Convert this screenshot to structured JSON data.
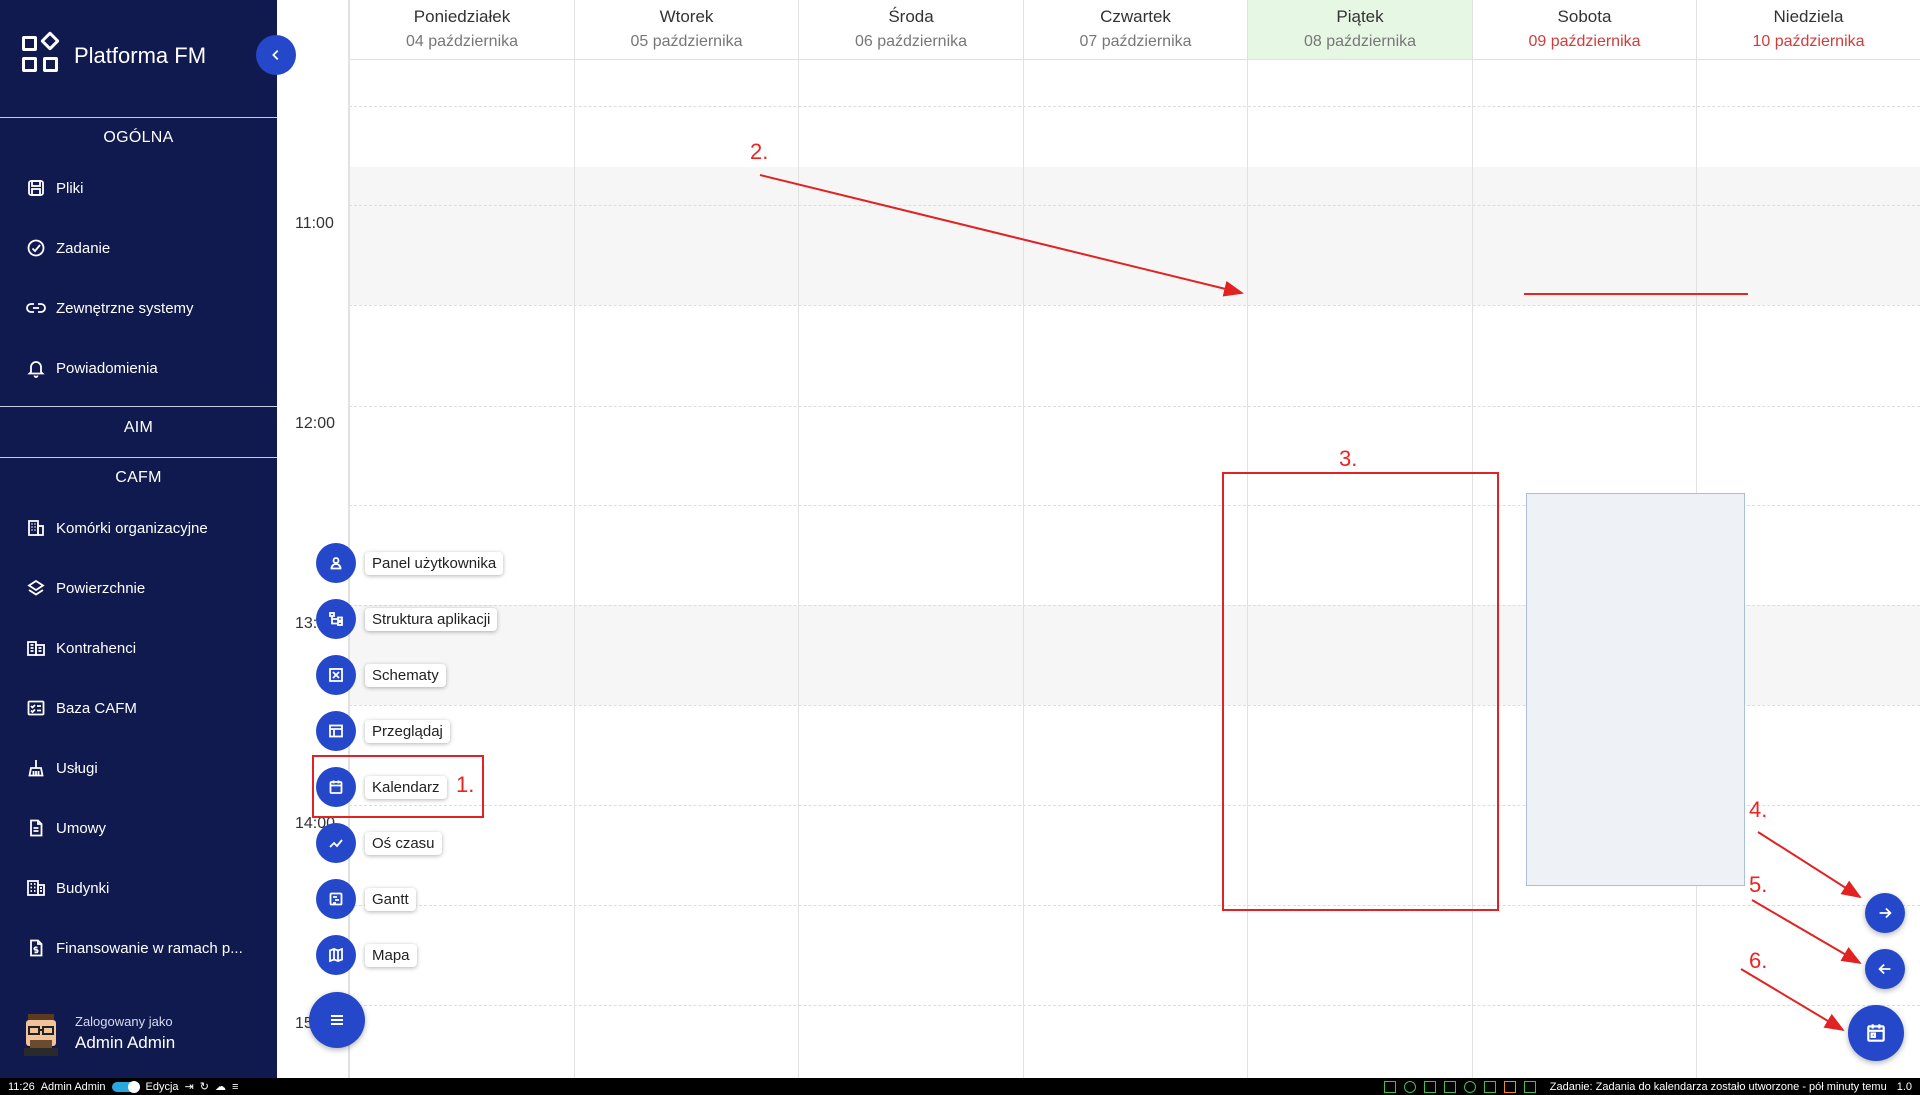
{
  "app": {
    "title": "Platforma FM"
  },
  "sidebar": {
    "sections": {
      "general": "OGÓLNA",
      "aim": "AIM",
      "cafm": "CAFM"
    },
    "general_items": [
      {
        "label": "Pliki",
        "icon": "save-icon"
      },
      {
        "label": "Zadanie",
        "icon": "check-circle-icon"
      },
      {
        "label": "Zewnętrzne systemy",
        "icon": "link-icon"
      },
      {
        "label": "Powiadomienia",
        "icon": "bell-icon"
      }
    ],
    "cafm_items": [
      {
        "label": "Komórki organizacyjne",
        "icon": "building-icon"
      },
      {
        "label": "Powierzchnie",
        "icon": "layers-icon"
      },
      {
        "label": "Kontrahenci",
        "icon": "contractors-icon"
      },
      {
        "label": "Baza CAFM",
        "icon": "checklist-icon"
      },
      {
        "label": "Usługi",
        "icon": "cleaning-icon"
      },
      {
        "label": "Umowy",
        "icon": "document-icon"
      },
      {
        "label": "Budynki",
        "icon": "buildings-icon"
      },
      {
        "label": "Finansowanie w ramach p...",
        "icon": "finance-doc-icon"
      }
    ],
    "user": {
      "caption": "Zalogowany jako",
      "name": "Admin Admin"
    }
  },
  "calendar": {
    "days": [
      {
        "name": "Poniedziałek",
        "date": "04 października",
        "weekend": false,
        "today": false
      },
      {
        "name": "Wtorek",
        "date": "05 października",
        "weekend": false,
        "today": false
      },
      {
        "name": "Środa",
        "date": "06 października",
        "weekend": false,
        "today": false
      },
      {
        "name": "Czwartek",
        "date": "07 października",
        "weekend": false,
        "today": false
      },
      {
        "name": "Piątek",
        "date": "08 października",
        "weekend": false,
        "today": true
      },
      {
        "name": "Sobota",
        "date": "09 października",
        "weekend": true,
        "today": false
      },
      {
        "name": "Niedziela",
        "date": "10 października",
        "weekend": true,
        "today": false
      }
    ],
    "times": [
      "11:00",
      "12:00",
      "13:00",
      "14:00",
      "15:00"
    ],
    "colors": {
      "today_bg": "#e6f7e3",
      "weekend_text": "#d23b3b",
      "accent": "#2547c9"
    }
  },
  "speed_dial": {
    "items": [
      {
        "label": "Panel użytkownika",
        "icon": "user-icon"
      },
      {
        "label": "Struktura aplikacji",
        "icon": "sitemap-icon"
      },
      {
        "label": "Schematy",
        "icon": "schema-icon"
      },
      {
        "label": "Przeglądaj",
        "icon": "table-icon"
      },
      {
        "label": "Kalendarz",
        "icon": "calendar-icon"
      },
      {
        "label": "Oś czasu",
        "icon": "timeline-icon"
      },
      {
        "label": "Gantt",
        "icon": "gantt-icon"
      },
      {
        "label": "Mapa",
        "icon": "map-icon"
      }
    ]
  },
  "annotations": {
    "labels": [
      "1.",
      "2.",
      "3.",
      "4.",
      "5.",
      "6."
    ],
    "color": "#e22222"
  },
  "statusbar": {
    "time": "11:26",
    "user": "Admin Admin",
    "mode": "Edycja",
    "message": "Zadanie: Zadania do kalendarza zostało utworzone - pół minuty temu",
    "version": "1.0"
  }
}
